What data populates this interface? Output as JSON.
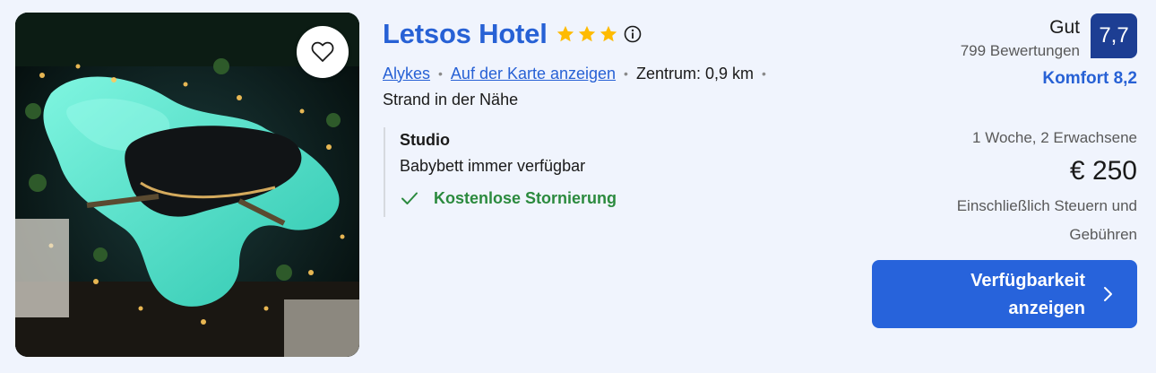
{
  "hotel": {
    "name": "Letsos Hotel",
    "star_count": 3,
    "location_link": "Alykes",
    "map_link": "Auf der Karte anzeigen",
    "distance": "Zentrum: 0,9 km",
    "beach_note": "Strand in der Nähe"
  },
  "room": {
    "name": "Studio",
    "extra": "Babybett immer verfügbar",
    "cancellation": "Kostenlose Stornierung"
  },
  "rating": {
    "word": "Gut",
    "reviews": "799 Bewertungen",
    "score": "7,7",
    "comfort": "Komfort 8,2"
  },
  "pricing": {
    "stay_details": "1 Woche, 2 Erwachsene",
    "price": "€ 250",
    "tax_note": "Einschließlich Steuern und Gebühren"
  },
  "cta": {
    "label": "Verfügbarkeit anzeigen"
  },
  "icons": {
    "favorite": "heart-icon",
    "star": "star-icon",
    "info": "info-icon",
    "check": "check-icon",
    "chevron": "chevron-right-icon"
  },
  "colors": {
    "brand_blue": "#2761d5",
    "badge_blue": "#1d3e93",
    "star_gold": "#febb02",
    "success_green": "#2b8a3e",
    "button_blue": "#2763db"
  }
}
